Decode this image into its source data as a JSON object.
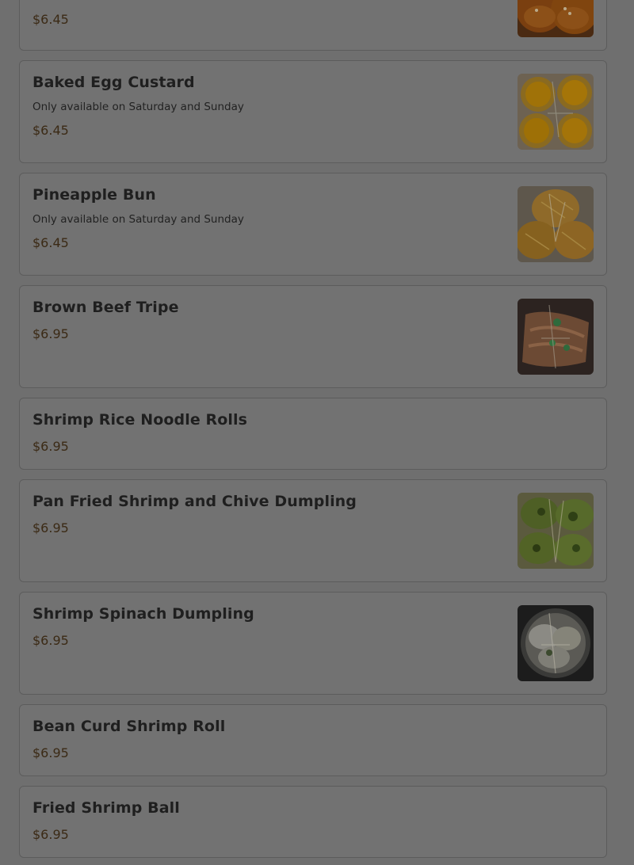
{
  "items": [
    {
      "name": "",
      "description": "",
      "price": "$6.45",
      "image": "pastry-photo"
    },
    {
      "name": "Baked Egg Custard",
      "description": "Only available on Saturday and Sunday",
      "price": "$6.45",
      "image": "egg-tart-photo"
    },
    {
      "name": "Pineapple Bun",
      "description": "Only available on Saturday and Sunday",
      "price": "$6.45",
      "image": "pineapple-bun-photo"
    },
    {
      "name": "Brown Beef Tripe",
      "description": "",
      "price": "$6.95",
      "image": "beef-tripe-photo"
    },
    {
      "name": "Shrimp Rice Noodle Rolls",
      "description": "",
      "price": "$6.95",
      "image": ""
    },
    {
      "name": "Pan Fried Shrimp and Chive Dumpling",
      "description": "",
      "price": "$6.95",
      "image": "chive-dumpling-photo"
    },
    {
      "name": "Shrimp Spinach Dumpling",
      "description": "",
      "price": "$6.95",
      "image": "spinach-dumpling-photo"
    },
    {
      "name": "Bean Curd Shrimp Roll",
      "description": "",
      "price": "$6.95",
      "image": ""
    },
    {
      "name": "Fried Shrimp Ball",
      "description": "",
      "price": "$6.95",
      "image": ""
    }
  ],
  "colors": {
    "overlay": "#6f6f6f",
    "card": "#727272",
    "price": "#3b2a15"
  }
}
